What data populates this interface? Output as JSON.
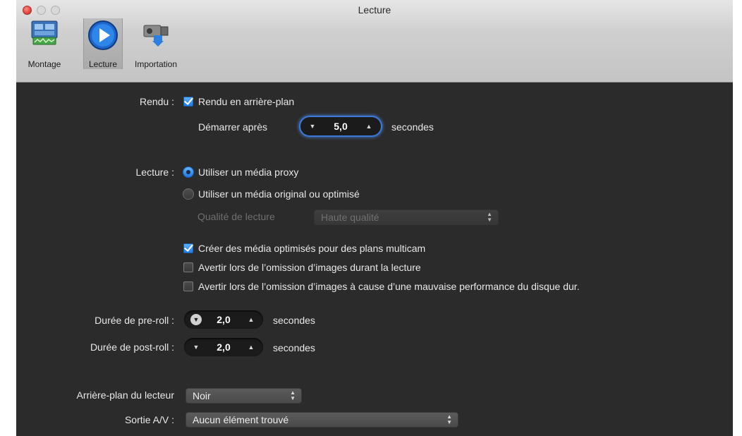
{
  "window": {
    "title": "Lecture"
  },
  "toolbar": {
    "items": [
      {
        "label": "Montage",
        "icon": "montage-icon"
      },
      {
        "label": "Lecture",
        "icon": "play-icon",
        "selected": true
      },
      {
        "label": "Importation",
        "icon": "camera-import-icon"
      }
    ]
  },
  "rendu": {
    "label": "Rendu :",
    "background_render": {
      "label": "Rendu en arrière-plan",
      "checked": true
    },
    "start_after_label": "Démarrer après",
    "start_after_value": "5,0",
    "start_after_unit": "secondes"
  },
  "lecture": {
    "label": "Lecture :",
    "proxy": {
      "label": "Utiliser un média proxy",
      "selected": true
    },
    "original": {
      "label": "Utiliser un média original ou optimisé",
      "selected": false
    },
    "quality_label": "Qualité de lecture",
    "quality_value": "Haute qualité",
    "multicam": {
      "label": "Créer des média optimisés pour des plans multicam",
      "checked": true
    },
    "warn_dropped": {
      "label": "Avertir lors de l’omission d’images durant la lecture",
      "checked": false
    },
    "warn_disk": {
      "label": "Avertir lors de l’omission d’images à cause d’une mauvaise performance du disque dur.",
      "checked": false
    }
  },
  "preroll": {
    "label": "Durée de pre-roll :",
    "value": "2,0",
    "unit": "secondes"
  },
  "postroll": {
    "label": "Durée de post-roll :",
    "value": "2,0",
    "unit": "secondes"
  },
  "player_bg": {
    "label": "Arrière-plan du lecteur",
    "value": "Noir"
  },
  "av_output": {
    "label": "Sortie A/V :",
    "value": "Aucun élément trouvé"
  },
  "colors": {
    "accent": "#2a82f0",
    "panel_bg": "#2b2b2b",
    "close_button": "#e0443e"
  }
}
